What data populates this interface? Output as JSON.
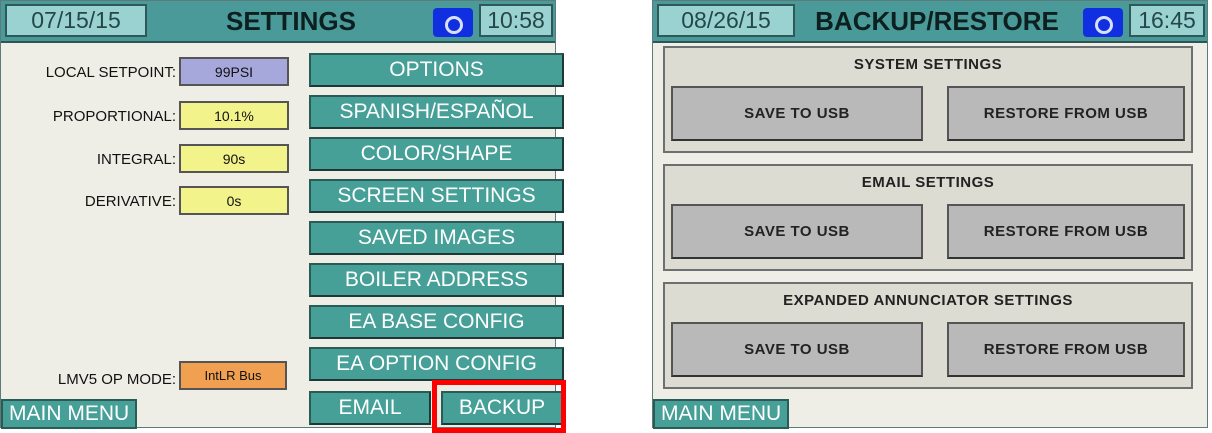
{
  "settings_screen": {
    "date": "07/15/15",
    "title": "SETTINGS",
    "time": "10:58",
    "fields": [
      {
        "label": "LOCAL SETPOINT:",
        "value": "99PSI",
        "color": "#a6a8dc"
      },
      {
        "label": "PROPORTIONAL:",
        "value": "10.1%",
        "color": "#f3f38c"
      },
      {
        "label": "INTEGRAL:",
        "value": "90s",
        "color": "#f3f38c"
      },
      {
        "label": "DERIVATIVE:",
        "value": "0s",
        "color": "#f3f38c"
      }
    ],
    "mode": {
      "label": "LMV5 OP MODE:",
      "value": "IntLR Bus",
      "color": "#f0a050"
    },
    "buttons": [
      "OPTIONS",
      "SPANISH/ESPAÑOL",
      "COLOR/SHAPE",
      "SCREEN SETTINGS",
      "SAVED IMAGES",
      "BOILER ADDRESS",
      "EA BASE CONFIG",
      "EA OPTION CONFIG"
    ],
    "email_button": "EMAIL",
    "backup_button": "BACKUP",
    "main_menu": "MAIN MENU"
  },
  "backup_screen": {
    "date": "08/26/15",
    "title": "BACKUP/RESTORE",
    "time": "16:45",
    "sections": [
      {
        "title": "SYSTEM SETTINGS",
        "save": "SAVE TO USB",
        "restore": "RESTORE FROM USB"
      },
      {
        "title": "EMAIL SETTINGS",
        "save": "SAVE TO USB",
        "restore": "RESTORE FROM USB"
      },
      {
        "title": "EXPANDED ANNUNCIATOR SETTINGS",
        "save": "SAVE TO USB",
        "restore": "RESTORE FROM USB"
      }
    ],
    "main_menu": "MAIN MENU"
  },
  "colors": {
    "header": "#4a9a9a",
    "button": "#46a098",
    "highlight": "#ff0000"
  }
}
